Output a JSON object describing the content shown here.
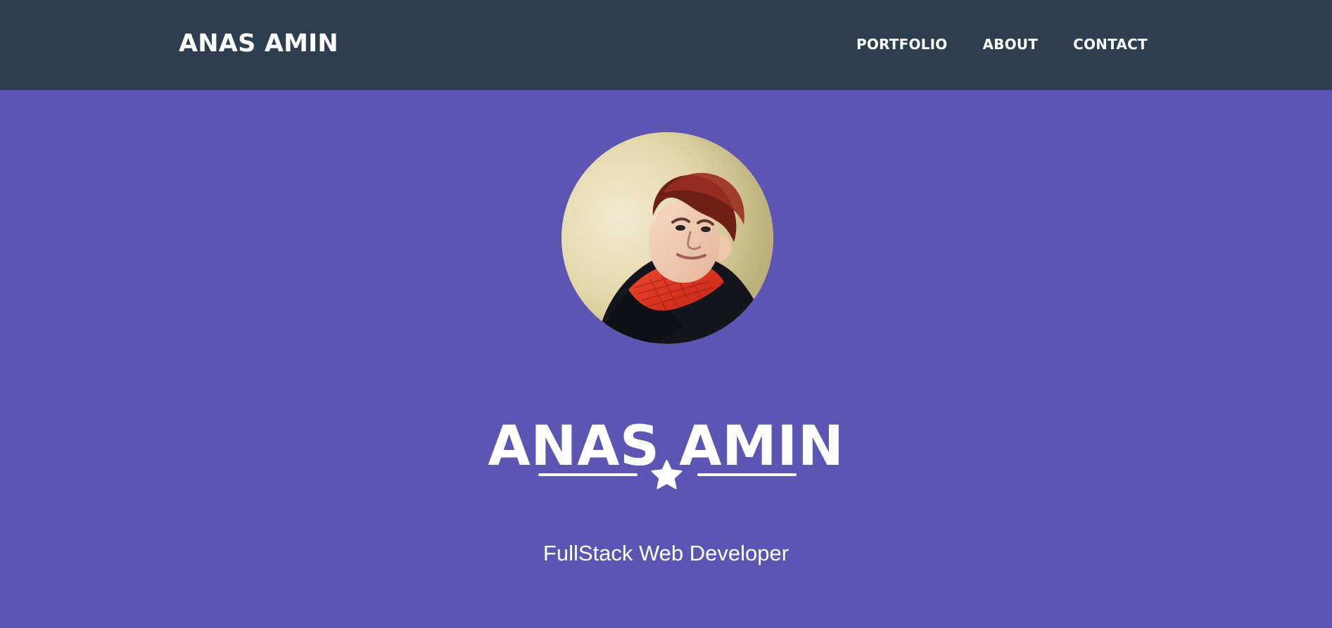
{
  "navbar": {
    "brand": "ANAS AMIN",
    "links": [
      {
        "label": "PORTFOLIO"
      },
      {
        "label": "ABOUT"
      },
      {
        "label": "CONTACT"
      }
    ],
    "background": "#2c3e50"
  },
  "hero": {
    "background": "#5d55b4",
    "avatar": {
      "alt": "Profile photo",
      "icon": "profile-photo"
    },
    "title": "ANAS AMIN",
    "divider_icon": "star-icon",
    "subtitle": "FullStack Web Developer"
  }
}
